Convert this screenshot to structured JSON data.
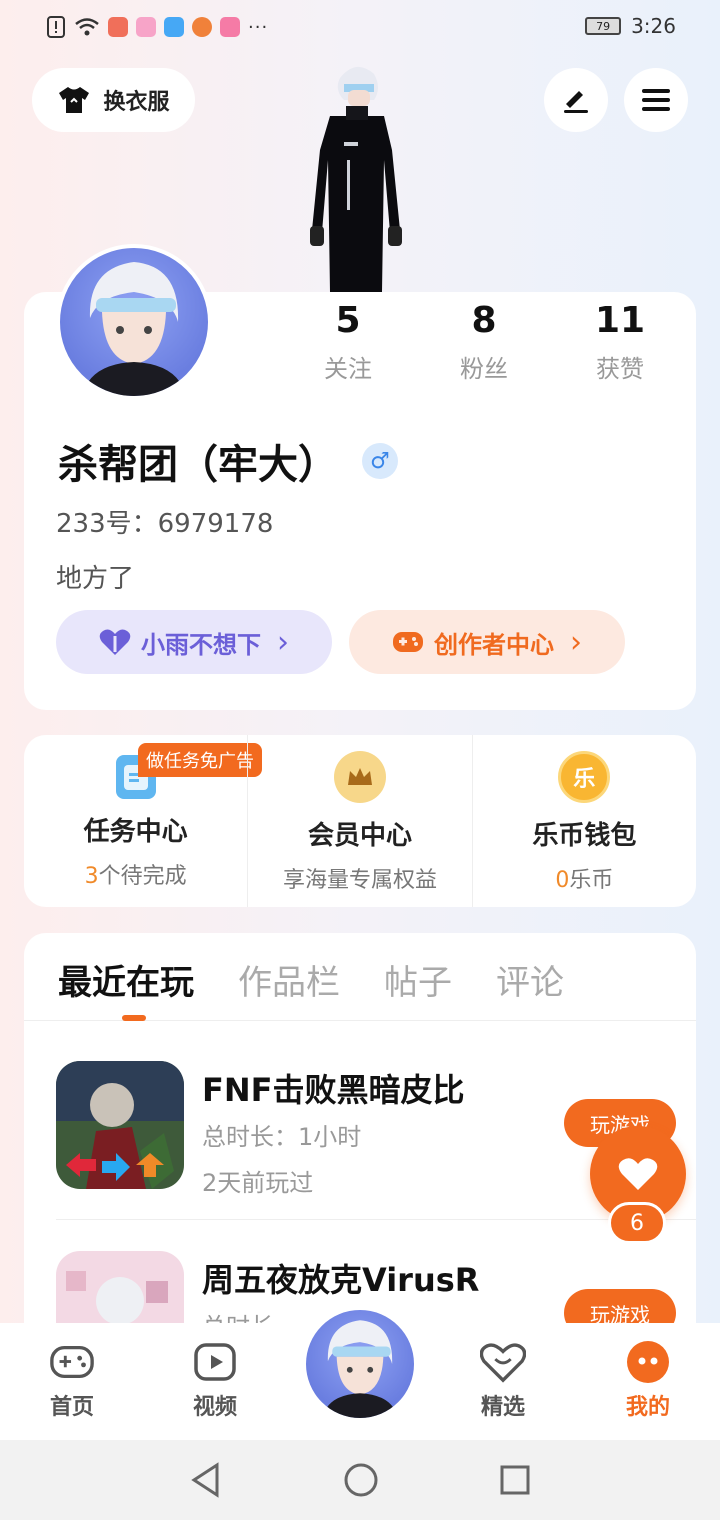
{
  "status_bar": {
    "time": "3:26",
    "battery": "79",
    "overflow": "···",
    "app_icon_colors": [
      "#f06f5a",
      "#f7a4c8",
      "#46a8f5",
      "#f0813a",
      "#f57ba6"
    ]
  },
  "header": {
    "outfit_label": "换衣服",
    "edit_icon": "pen-icon",
    "menu_icon": "hamburger-icon"
  },
  "profile": {
    "stats": [
      {
        "value": "5",
        "label": "关注"
      },
      {
        "value": "8",
        "label": "粉丝"
      },
      {
        "value": "11",
        "label": "获赞"
      }
    ],
    "username": "杀帮团（牢大）",
    "gender_symbol": "♂",
    "uid": "233号：6979178",
    "bio": "地方了",
    "pill_left": "小雨不想下",
    "pill_right": "创作者中心",
    "chevron": "›"
  },
  "services": [
    {
      "title": "任务中心",
      "sub_highlight": "3",
      "sub_text": "个待完成",
      "tag": "做任务免广告",
      "icon": "task-icon"
    },
    {
      "title": "会员中心",
      "sub_highlight": "",
      "sub_text": "享海量专属权益",
      "icon": "crown-icon"
    },
    {
      "title": "乐币钱包",
      "sub_highlight": "0",
      "sub_text": "乐币",
      "icon": "coin-icon",
      "icon_text": "乐"
    }
  ],
  "tabs": [
    {
      "label": "最近在玩",
      "active": true
    },
    {
      "label": "作品栏",
      "active": false
    },
    {
      "label": "帖子",
      "active": false
    },
    {
      "label": "评论",
      "active": false
    }
  ],
  "games": [
    {
      "name": "FNF击败黑暗皮比",
      "duration": "总时长：1小时",
      "last_played": "2天前玩过",
      "button": "玩游戏"
    },
    {
      "name": "周五夜放克VirusR",
      "duration": "总时长",
      "last_played": "",
      "button": "玩游戏"
    }
  ],
  "float_like": {
    "count": "6"
  },
  "bottom_nav": [
    {
      "label": "首页",
      "icon": "gamepad-icon",
      "active": false
    },
    {
      "label": "视频",
      "icon": "video-icon",
      "active": false
    },
    {
      "label": "精选",
      "icon": "heart-badge-icon",
      "active": false
    },
    {
      "label": "我的",
      "icon": "me-icon",
      "active": true
    }
  ],
  "colors": {
    "accent": "#f26a1f",
    "purple": "#6b5fd8",
    "gender_blue": "#3a86e8"
  }
}
